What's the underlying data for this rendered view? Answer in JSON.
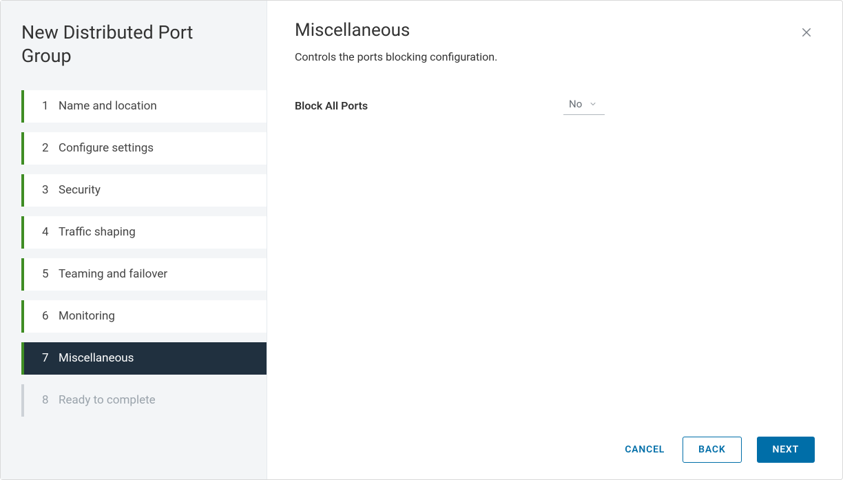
{
  "sidebar": {
    "title": "New Distributed Port Group",
    "steps": [
      {
        "num": "1",
        "label": "Name and location",
        "state": "done"
      },
      {
        "num": "2",
        "label": "Configure settings",
        "state": "done"
      },
      {
        "num": "3",
        "label": "Security",
        "state": "done"
      },
      {
        "num": "4",
        "label": "Traffic shaping",
        "state": "done"
      },
      {
        "num": "5",
        "label": "Teaming and failover",
        "state": "done"
      },
      {
        "num": "6",
        "label": "Monitoring",
        "state": "done"
      },
      {
        "num": "7",
        "label": "Miscellaneous",
        "state": "active"
      },
      {
        "num": "8",
        "label": "Ready to complete",
        "state": "future"
      }
    ]
  },
  "main": {
    "title": "Miscellaneous",
    "subtitle": "Controls the ports blocking configuration.",
    "form": {
      "block_all_ports": {
        "label": "Block All Ports",
        "value": "No"
      }
    }
  },
  "footer": {
    "cancel": "CANCEL",
    "back": "BACK",
    "next": "NEXT"
  }
}
